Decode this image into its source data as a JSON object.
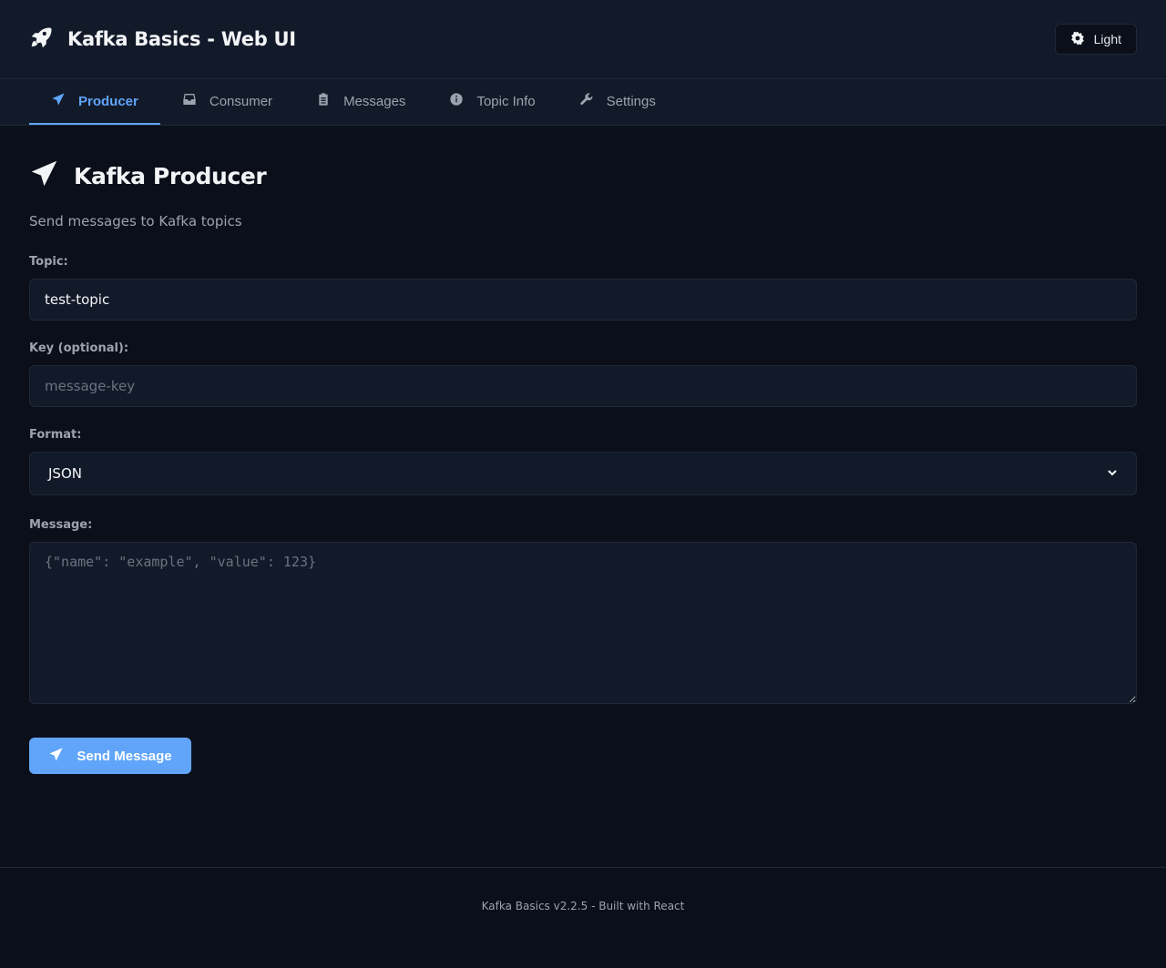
{
  "header": {
    "title": "Kafka Basics - Web UI",
    "brand_icon": "rocket-icon",
    "theme_button_label": "Light",
    "theme_button_icon": "sun-icon"
  },
  "tabs": [
    {
      "label": "Producer",
      "icon": "paper-plane-icon",
      "active": true
    },
    {
      "label": "Consumer",
      "icon": "inbox-icon",
      "active": false
    },
    {
      "label": "Messages",
      "icon": "clipboard-list-icon",
      "active": false
    },
    {
      "label": "Topic Info",
      "icon": "info-circle-icon",
      "active": false
    },
    {
      "label": "Settings",
      "icon": "wrench-icon",
      "active": false
    }
  ],
  "page": {
    "title": "Kafka Producer",
    "subtitle": "Send messages to Kafka topics",
    "title_icon": "paper-plane-icon"
  },
  "form": {
    "topic_label": "Topic:",
    "topic_value": "test-topic",
    "key_label": "Key (optional):",
    "key_placeholder": "message-key",
    "key_value": "",
    "format_label": "Format:",
    "format_value": "JSON",
    "message_label": "Message:",
    "message_placeholder": "{\"name\": \"example\", \"value\": 123}",
    "message_value": "",
    "send_button_label": "Send Message"
  },
  "footer": {
    "text": "Kafka Basics v2.2.5 - Built with React"
  },
  "colors": {
    "background": "#0b0f1a",
    "surface": "#121a2a",
    "border": "#1f2937",
    "accent": "#60a5fa",
    "text_primary": "#f3f4f6",
    "text_muted": "#9ca3af"
  }
}
